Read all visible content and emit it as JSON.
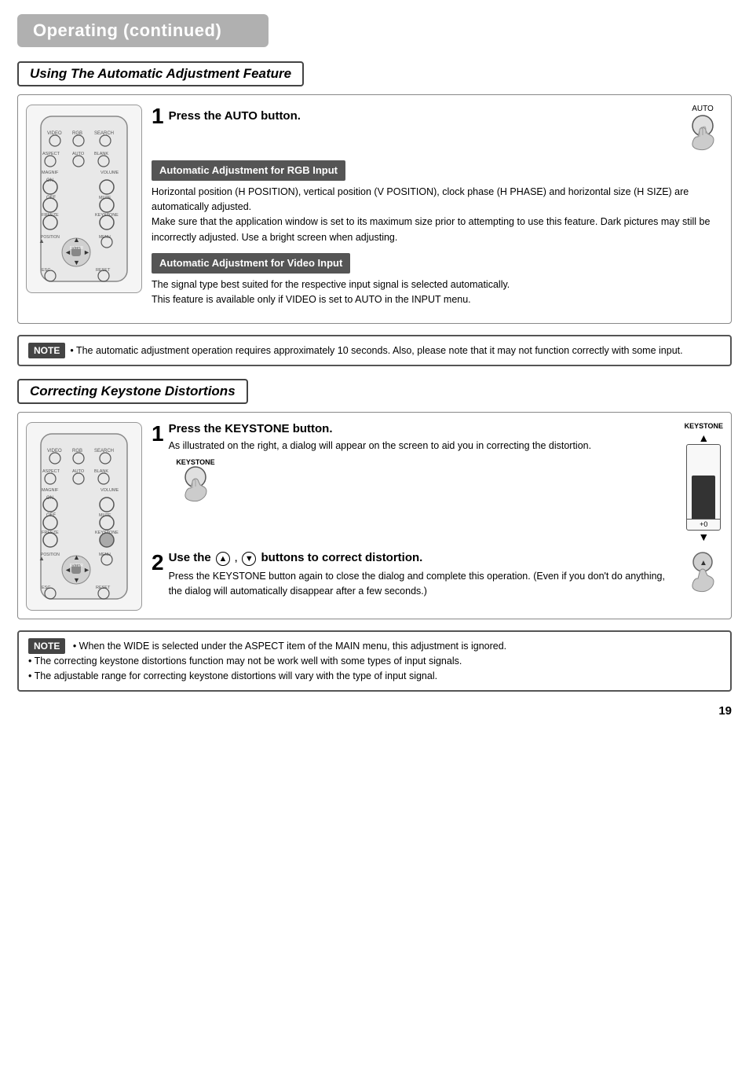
{
  "page": {
    "title": "Operating (continued)",
    "page_number": "19"
  },
  "section1": {
    "heading": "Using The Automatic Adjustment Feature",
    "step1": {
      "number": "1",
      "title": "Press the AUTO button.",
      "auto_label": "AUTO"
    },
    "rgb_box": {
      "title": "Automatic Adjustment for RGB Input",
      "body": "Horizontal position (H POSITION), vertical position (V POSITION), clock phase (H PHASE) and horizontal size (H SIZE) are automatically adjusted.\nMake sure that the application window is set to its maximum size prior to attempting to use this feature. Dark pictures may still be incorrectly adjusted. Use a bright screen when adjusting."
    },
    "video_box": {
      "title": "Automatic Adjustment for Video Input",
      "body": "The signal type best suited for the respective input signal is selected automatically.\nThis feature is available only if VIDEO is set to AUTO in the INPUT menu."
    },
    "note": "• The automatic adjustment operation requires approximately 10 seconds. Also, please note that it may not function correctly with some input.",
    "note_label": "NOTE"
  },
  "section2": {
    "heading": "Correcting Keystone Distortions",
    "step1": {
      "number": "1",
      "title": "Press the KEYSTONE button.",
      "body": "As illustrated on the right, a dialog will appear on the screen to aid you in correcting the distortion.",
      "keystone_label": "KEYSTONE",
      "bar_label": "KEYSTONE",
      "bar_value": "+0",
      "arrow_up": "▲",
      "arrow_down": "▼"
    },
    "step2": {
      "number": "2",
      "title_prefix": "Use the ",
      "title_suffix": " buttons to correct distortion.",
      "body": "Press the KEYSTONE button again to close the dialog and complete this operation. (Even if you don't do anything, the dialog will automatically disappear after a few seconds.)"
    },
    "note_label": "NOTE",
    "note_lines": [
      "• When the WIDE is selected under the ASPECT item of the MAIN menu, this adjustment is ignored.",
      "• The correcting keystone distortions function may not be work well with some types of input signals.",
      "• The adjustable range for correcting keystone distortions will vary with the type of input signal."
    ]
  }
}
